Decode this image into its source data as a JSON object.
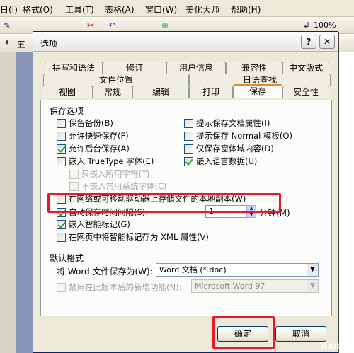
{
  "app": {
    "menu": [
      "日(I)",
      "格式(O)",
      "工具(T)",
      "表格(A)",
      "窗口(W)",
      "美化大师",
      "帮助(H)"
    ],
    "zoom": "100%",
    "font_fragment": "五"
  },
  "dialog": {
    "title": "选项",
    "help_glyph": "?",
    "close_glyph": "✕",
    "tabs_row1": [
      "拼写和语法",
      "修订",
      "用户信息",
      "兼容性",
      "中文版式"
    ],
    "tabs_row2": [
      "文件位置",
      "日语查找"
    ],
    "tabs_row3": [
      "视图",
      "常规",
      "编辑",
      "打印",
      "保存",
      "安全性"
    ],
    "active_tab": "保存",
    "save_options": {
      "label": "保存选项",
      "left": [
        {
          "label": "保留备份(B)",
          "checked": false
        },
        {
          "label": "允许快速保存(F)",
          "checked": false
        },
        {
          "label": "允许后台保存(A)",
          "checked": true
        },
        {
          "label": "嵌入 TrueType 字体(E)",
          "checked": false
        }
      ],
      "right": [
        {
          "label": "提示保存文档属性(I)",
          "checked": false
        },
        {
          "label": "提示保存 Normal 模板(O)",
          "checked": false
        },
        {
          "label": "仅保存窗体域内容(D)",
          "checked": false
        },
        {
          "label": "嵌入语言数据(U)",
          "checked": true
        }
      ],
      "sub": [
        {
          "label": "只嵌入所用字符(T)",
          "checked": false
        },
        {
          "label": "不嵌入常用系统字体(C)",
          "checked": false
        }
      ],
      "network_copy": {
        "label": "在网络或可移动驱动器上存储文件的本地副本(W)",
        "checked": false
      },
      "autosave": {
        "label": "自动保存时间间隔(S):",
        "checked": true,
        "value": "1",
        "unit": "分钟(M)"
      },
      "smart_tags": {
        "label": "嵌入智能标记(G)",
        "checked": true
      },
      "xml_tags": {
        "label": "在网页中将智能标记存为 XML 属性(V)",
        "checked": false
      }
    },
    "default_format": {
      "label": "默认格式",
      "save_as_label": "将 Word 文件保存为(W):",
      "save_as_value": "Word 文档 (*.doc)",
      "disable_label": "禁用在此版本后的新增功能(N):",
      "disable_value": "Microsoft Word 97"
    },
    "buttons": {
      "ok": "确定",
      "cancel": "取消"
    }
  },
  "watermark": "Baidu"
}
